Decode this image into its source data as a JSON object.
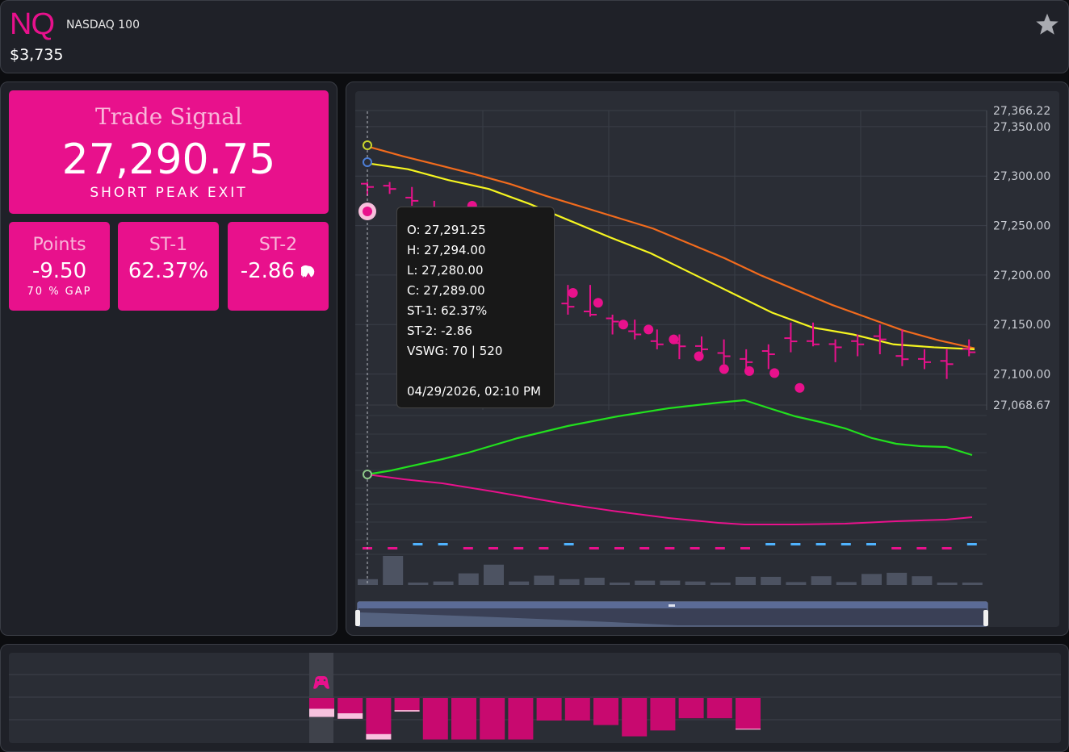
{
  "header": {
    "ticker": "NQ",
    "name": "NASDAQ 100",
    "price": "$3,735",
    "favorite_icon": "star-icon"
  },
  "signal": {
    "title": "Trade Signal",
    "value": "27,290.75",
    "label": "SHORT PEAK EXIT"
  },
  "stats": [
    {
      "title": "Points",
      "value": "-9.50",
      "sub": "70 % GAP"
    },
    {
      "title": "ST-1",
      "value": "62.37%",
      "sub": ""
    },
    {
      "title": "ST-2",
      "value": "-2.86",
      "sub": "",
      "icon": "pacman-icon"
    }
  ],
  "tooltip": {
    "open": "O: 27,291.25",
    "high": "H: 27,294.00",
    "low": "L: 27,280.00",
    "close": "C: 27,289.00",
    "st1": "ST-1: 62.37%",
    "st2": "ST-2: -2.86",
    "vswg": "VSWG: 70 | 520",
    "time": "04/29/2026, 02:10 PM"
  },
  "colors": {
    "accent": "#e8118c",
    "orange_line": "#f26b1d",
    "yellow_line": "#f5f520",
    "green_line": "#22e01e",
    "magenta_line": "#e8118c",
    "blue_marker": "#4fb3ff",
    "volume": "#4d5362"
  },
  "chart_data": {
    "type": "line",
    "y_axis_labels": [
      "27,366.22",
      "27,350.00",
      "27,300.00",
      "27,250.00",
      "27,200.00",
      "27,150.00",
      "27,100.00",
      "27,068.67"
    ],
    "ylim": [
      27068.67,
      27366.22
    ],
    "candles_hlc": [
      {
        "h": 27294,
        "l": 27280,
        "c": 27289
      },
      {
        "h": 27294,
        "l": 27282,
        "c": 27287
      },
      {
        "h": 27289,
        "l": 27270,
        "c": 27275
      },
      {
        "h": 27275,
        "l": 27255,
        "c": 27262
      },
      {
        "h": 27262,
        "l": 27240,
        "c": 27245
      },
      {
        "h": 27245,
        "l": 27222,
        "c": 27228
      },
      {
        "h": 27228,
        "l": 27200,
        "c": 27205
      },
      {
        "h": 27205,
        "l": 27178,
        "c": 27182
      },
      {
        "h": 27185,
        "l": 27168,
        "c": 27170
      },
      {
        "h": 27190,
        "l": 27160,
        "c": 27168
      },
      {
        "h": 27190,
        "l": 27158,
        "c": 27160
      },
      {
        "h": 27160,
        "l": 27140,
        "c": 27153
      },
      {
        "h": 27155,
        "l": 27135,
        "c": 27140
      },
      {
        "h": 27145,
        "l": 27125,
        "c": 27130
      },
      {
        "h": 27140,
        "l": 27115,
        "c": 27128
      },
      {
        "h": 27138,
        "l": 27115,
        "c": 27125
      },
      {
        "h": 27135,
        "l": 27110,
        "c": 27118
      },
      {
        "h": 27125,
        "l": 27100,
        "c": 27112
      },
      {
        "h": 27130,
        "l": 27105,
        "c": 27120
      },
      {
        "h": 27152,
        "l": 27122,
        "c": 27133
      },
      {
        "h": 27152,
        "l": 27128,
        "c": 27130
      },
      {
        "h": 27135,
        "l": 27112,
        "c": 27127
      },
      {
        "h": 27140,
        "l": 27118,
        "c": 27130
      },
      {
        "h": 27150,
        "l": 27120,
        "c": 27135
      },
      {
        "h": 27145,
        "l": 27108,
        "c": 27115
      },
      {
        "h": 27125,
        "l": 27105,
        "c": 27112
      },
      {
        "h": 27125,
        "l": 27095,
        "c": 27110
      },
      {
        "h": 27135,
        "l": 27118,
        "c": 27122
      }
    ],
    "dots": [
      {
        "i": 4,
        "y": 27270
      },
      {
        "i": 5,
        "y": 27262
      },
      {
        "i": 6,
        "y": 27218
      },
      {
        "i": 7,
        "y": 27198
      },
      {
        "i": 8,
        "y": 27182
      },
      {
        "i": 9,
        "y": 27172
      },
      {
        "i": 10,
        "y": 27150
      },
      {
        "i": 11,
        "y": 27145
      },
      {
        "i": 12,
        "y": 27135
      },
      {
        "i": 13,
        "y": 27118
      },
      {
        "i": 14,
        "y": 27105
      },
      {
        "i": 15,
        "y": 27103
      },
      {
        "i": 16,
        "y": 27101
      },
      {
        "i": 17,
        "y": 27086
      }
    ],
    "orange_line": [
      27330,
      27320,
      27311,
      27302,
      27292,
      27280,
      27269,
      27258,
      27247,
      27232,
      27217,
      27200,
      27185,
      27170,
      27157,
      27144,
      27134,
      27126
    ],
    "yellow_line": [
      27313,
      27307,
      27296,
      27287,
      27272,
      27255,
      27238,
      27222,
      27202,
      27182,
      27162,
      27147,
      27140,
      27130,
      27127,
      27125
    ],
    "volume_relative": [
      0.2,
      1.0,
      0.05,
      0.12,
      0.4,
      0.7,
      0.12,
      0.32,
      0.2,
      0.25,
      0.05,
      0.15,
      0.15,
      0.12,
      0.05,
      0.28,
      0.28,
      0.1,
      0.3,
      0.1,
      0.38,
      0.42,
      0.3,
      0.05,
      0.08
    ]
  },
  "histogram": {
    "cursor_icon": "controller-icon",
    "bars_relative": [
      0.42,
      0.46,
      0.92,
      0.3,
      0.92,
      0.92,
      0.92,
      0.92,
      0.5,
      0.5,
      0.6,
      0.85,
      0.72,
      0.45,
      0.45,
      0.7
    ],
    "highlight_relative": [
      0.18,
      0.12,
      0.12,
      0.03,
      0,
      0,
      0,
      0,
      0,
      0,
      0,
      0,
      0,
      0,
      0,
      0.02
    ]
  }
}
